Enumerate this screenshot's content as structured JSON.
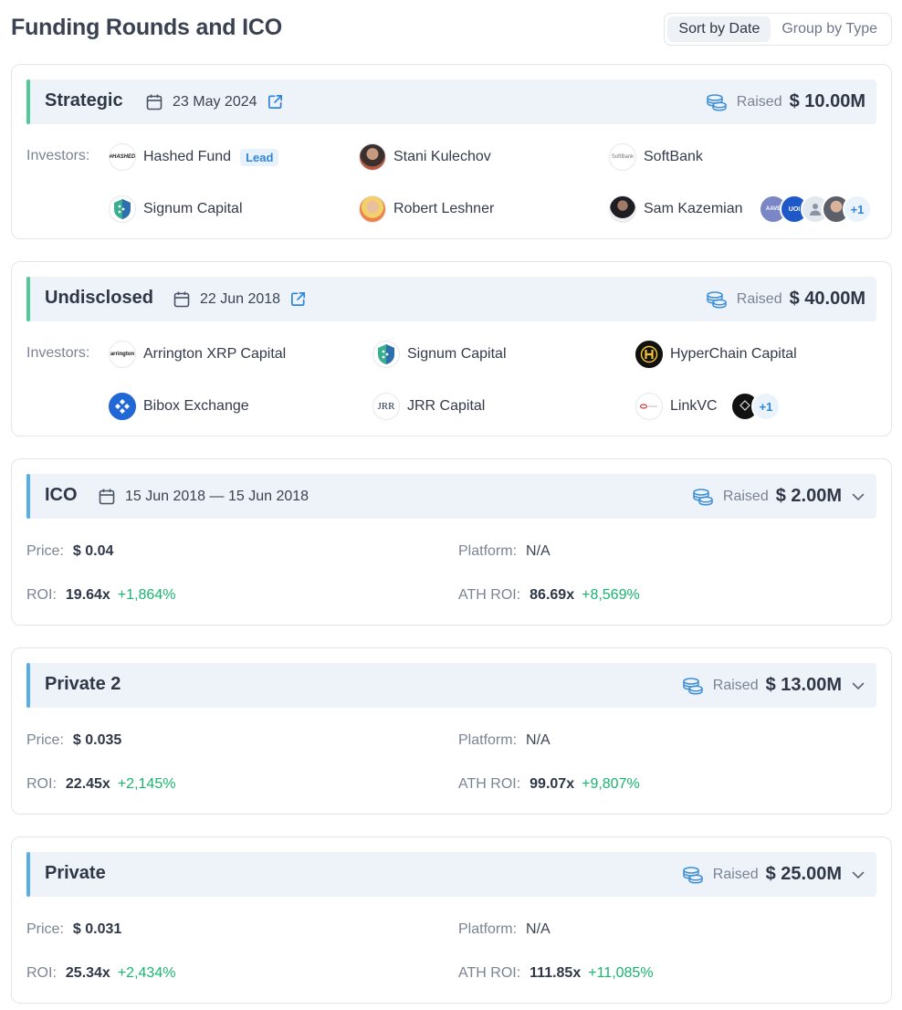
{
  "title": "Funding Rounds and ICO",
  "sort": {
    "options": [
      "Sort by Date",
      "Group by Type"
    ],
    "active": "Sort by Date"
  },
  "colors": {
    "accent_green": "#55c89a",
    "accent_blue": "#5aaee8",
    "positive": "#18b56f",
    "link": "#2f86d8"
  },
  "rounds": [
    {
      "type": "Strategic",
      "date": "23 May 2024",
      "raised_label": "Raised",
      "raised": "$ 10.00M",
      "investors_label": "Investors:",
      "investors": [
        {
          "name": "Hashed Fund",
          "badge": "Lead",
          "logo_text": "#HASHED"
        },
        {
          "name": "Stani Kulechov"
        },
        {
          "name": "SoftBank",
          "logo_text": "SoftBank"
        },
        {
          "name": "Signum Capital"
        },
        {
          "name": "Robert Leshner"
        },
        {
          "name": "Sam Kazemian"
        }
      ],
      "more_count": "+1",
      "stack_labels": [
        "AAVE",
        "UOI"
      ]
    },
    {
      "type": "Undisclosed",
      "date": "22 Jun 2018",
      "raised_label": "Raised",
      "raised": "$ 40.00M",
      "investors_label": "Investors:",
      "investors": [
        {
          "name": "Arrington XRP Capital",
          "logo_text": "arrington"
        },
        {
          "name": "Signum Capital"
        },
        {
          "name": "HyperChain Capital"
        },
        {
          "name": "Bibox Exchange"
        },
        {
          "name": "JRR Capital",
          "logo_text": "JRR"
        },
        {
          "name": "LinkVC"
        }
      ],
      "more_count": "+1"
    },
    {
      "type": "ICO",
      "date": "15 Jun 2018 — 15 Jun 2018",
      "raised_label": "Raised",
      "raised": "$ 2.00M",
      "price_label": "Price:",
      "price": "$ 0.04",
      "platform_label": "Platform:",
      "platform": "N/A",
      "roi_label": "ROI:",
      "roi": "19.64x",
      "roi_pct": "+1,864%",
      "ath_label": "ATH ROI:",
      "ath": "86.69x",
      "ath_pct": "+8,569%"
    },
    {
      "type": "Private 2",
      "raised_label": "Raised",
      "raised": "$ 13.00M",
      "price_label": "Price:",
      "price": "$ 0.035",
      "platform_label": "Platform:",
      "platform": "N/A",
      "roi_label": "ROI:",
      "roi": "22.45x",
      "roi_pct": "+2,145%",
      "ath_label": "ATH ROI:",
      "ath": "99.07x",
      "ath_pct": "+9,807%"
    },
    {
      "type": "Private",
      "raised_label": "Raised",
      "raised": "$ 25.00M",
      "price_label": "Price:",
      "price": "$ 0.031",
      "platform_label": "Platform:",
      "platform": "N/A",
      "roi_label": "ROI:",
      "roi": "25.34x",
      "roi_pct": "+2,434%",
      "ath_label": "ATH ROI:",
      "ath": "111.85x",
      "ath_pct": "+11,085%"
    }
  ]
}
